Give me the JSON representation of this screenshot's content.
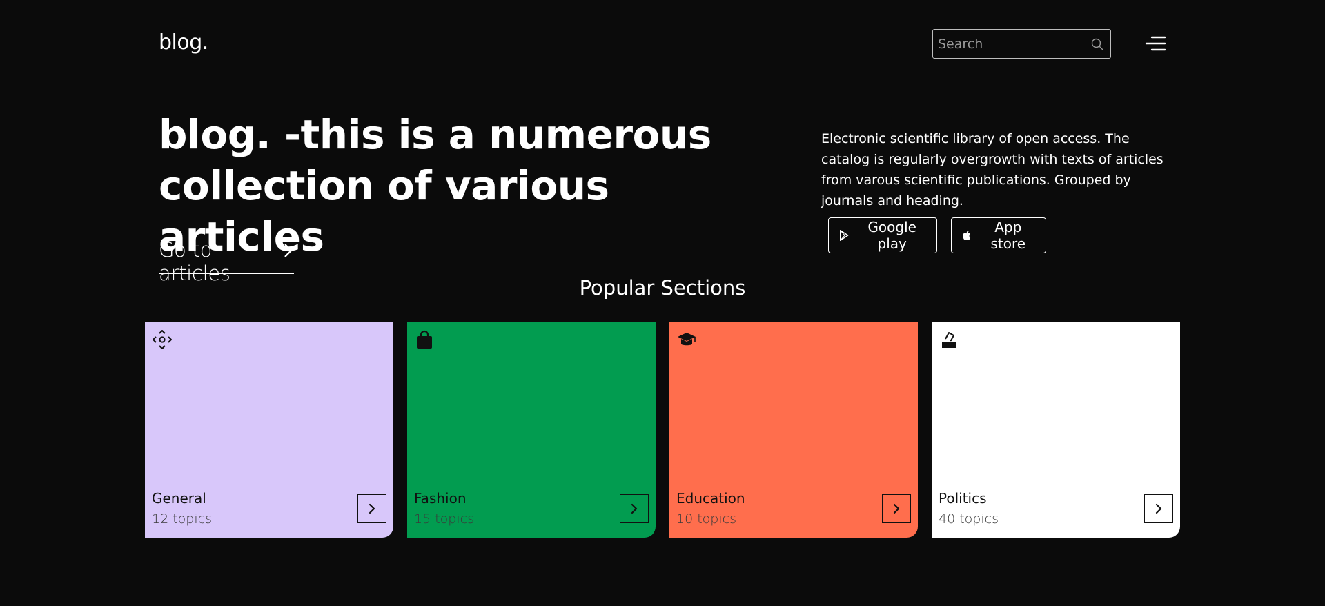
{
  "header": {
    "logo": "blog.",
    "search_placeholder": "Search"
  },
  "hero": {
    "title": "blog. -this is a numerous collection of various articles",
    "cta_label": "Go to articles",
    "description": "Electronic scientific library of open access. The catalog is regularly overgrowth with texts of articles from varous scientific publications. Grouped by journals and heading.",
    "google_label": "Google play",
    "apple_label": "App store"
  },
  "sections": {
    "title": "Popular Sections",
    "cards": [
      {
        "name": "General",
        "count": "12 topics",
        "color": "#d8c7fa",
        "icon": "move-icon"
      },
      {
        "name": "Fashion",
        "count": "15 topics",
        "color": "#029c50",
        "icon": "shopping-bag-icon"
      },
      {
        "name": "Education",
        "count": "10 topics",
        "color": "#ff6e4d",
        "icon": "graduation-cap-icon"
      },
      {
        "name": "Politics",
        "count": "40 topics",
        "color": "#ffffff",
        "icon": "ballot-box-icon"
      }
    ]
  }
}
